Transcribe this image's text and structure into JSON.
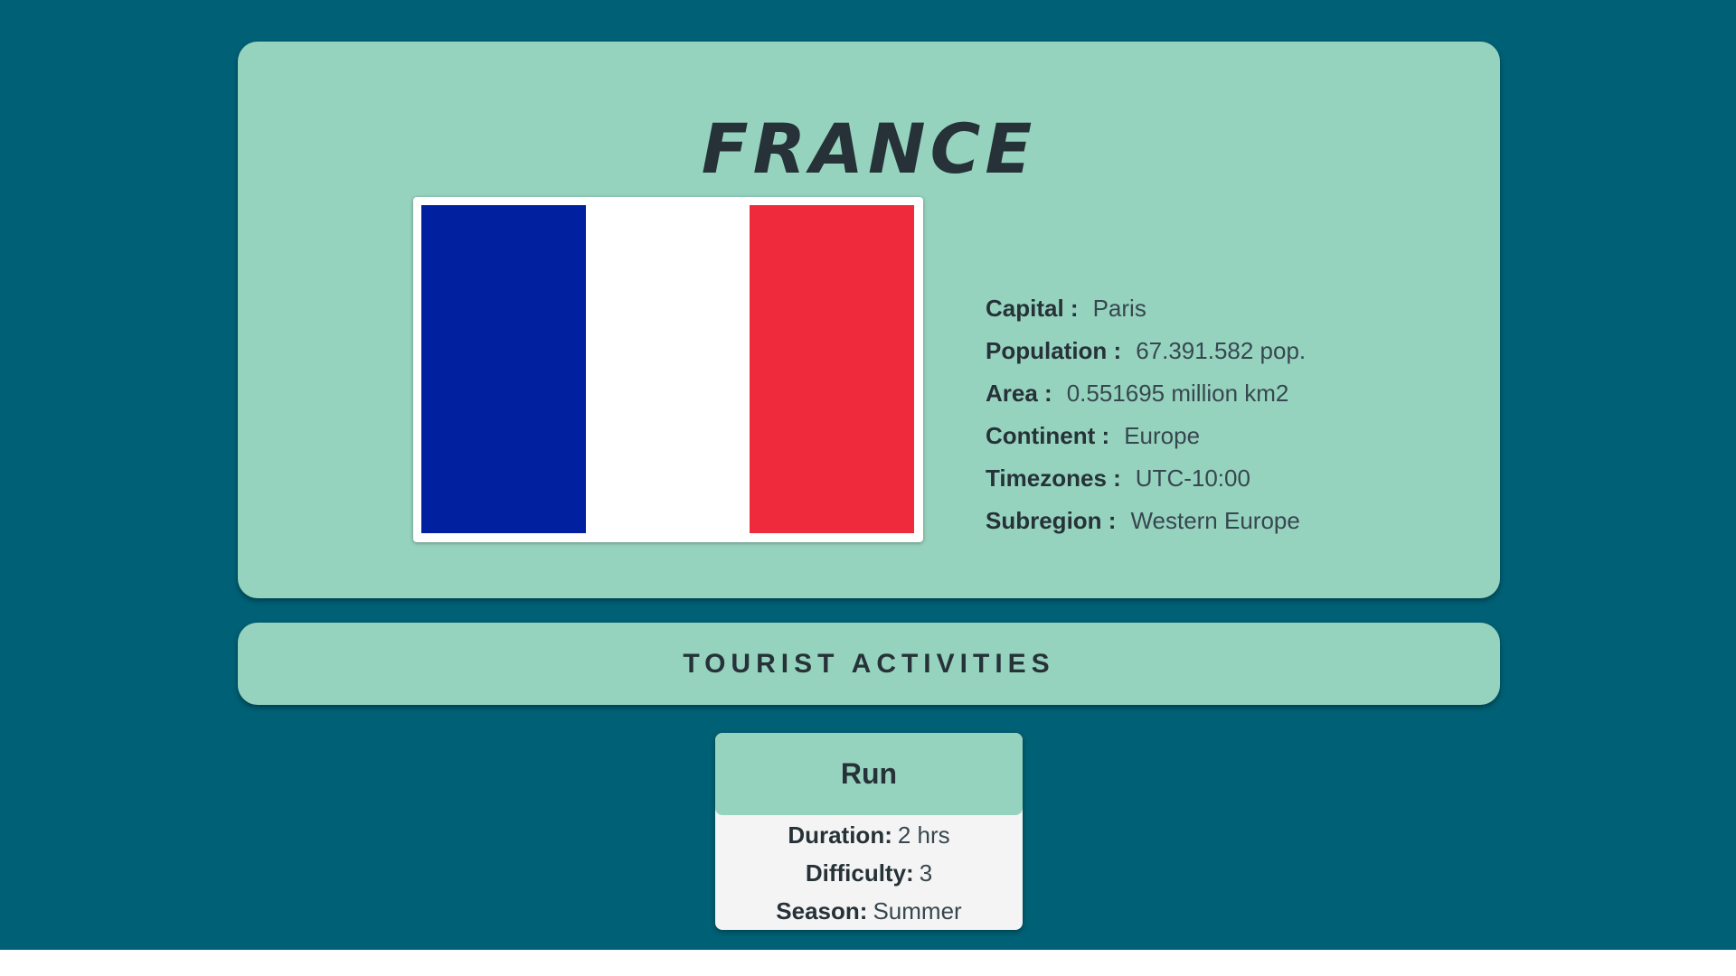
{
  "country": {
    "name": "FRANCE",
    "flag": {
      "stripes": [
        "#00209f",
        "#ffffff",
        "#ef2a3c"
      ]
    },
    "info": [
      {
        "label": "Capital :",
        "value": "Paris"
      },
      {
        "label": "Population :",
        "value": "67.391.582 pop."
      },
      {
        "label": "Area :",
        "value": "0.551695 million km2"
      },
      {
        "label": "Continent :",
        "value": "Europe"
      },
      {
        "label": "Timezones :",
        "value": "UTC-10:00"
      },
      {
        "label": "Subregion :",
        "value": "Western Europe"
      }
    ]
  },
  "activities": {
    "title": "TOURIST ACTIVITIES",
    "items": [
      {
        "name": "Run",
        "duration_label": "Duration:",
        "duration": "2 hrs",
        "difficulty_label": "Difficulty:",
        "difficulty": "3",
        "season_label": "Season:",
        "season": "Summer"
      }
    ]
  },
  "colors": {
    "background": "#006075",
    "card": "#96d3bf",
    "text": "#263238"
  }
}
